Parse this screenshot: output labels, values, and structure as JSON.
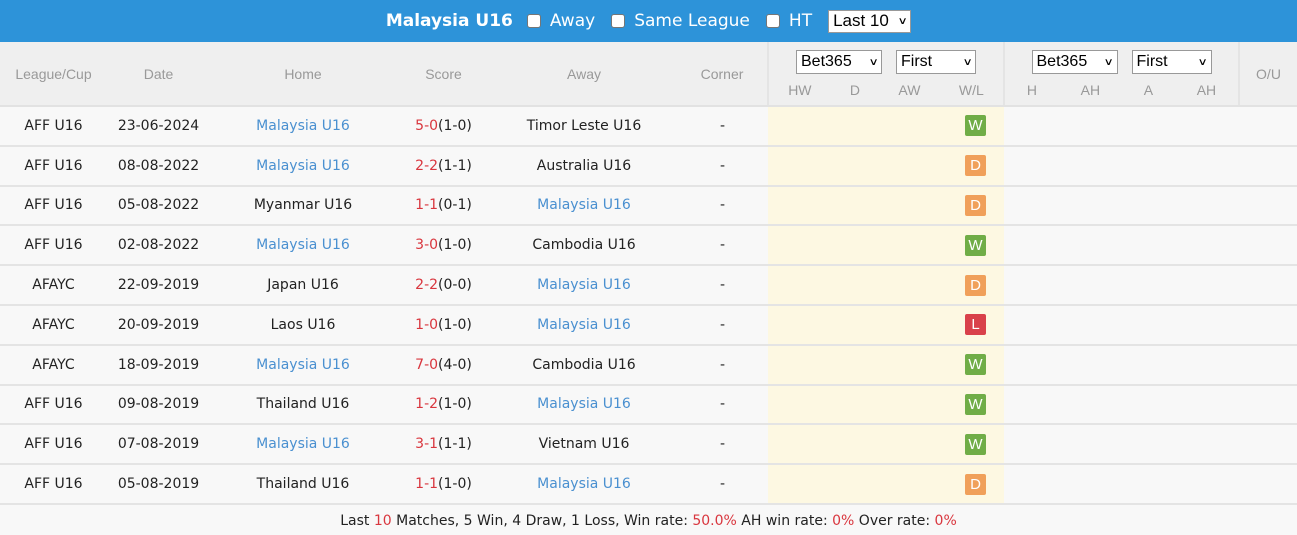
{
  "topbar": {
    "team": "Malaysia U16",
    "options": [
      {
        "label": "Away",
        "checked": false
      },
      {
        "label": "Same League",
        "checked": false
      },
      {
        "label": "HT",
        "checked": false
      }
    ],
    "range_select": "Last 10"
  },
  "colors": {
    "header_blue": "#2d93d9",
    "team_highlight": "#4a90d0",
    "score_red": "#d9363e",
    "win": "#70ad47",
    "draw": "#f0a05a",
    "loss": "#d9414a",
    "odds_bg": "#fdf8e2"
  },
  "columns": {
    "league": "League/Cup",
    "date": "Date",
    "home": "Home",
    "score": "Score",
    "away": "Away",
    "corner": "Corner",
    "odds_group": {
      "company": "Bet365",
      "type": "First",
      "sub": [
        "HW",
        "D",
        "AW",
        "W/L"
      ]
    },
    "ah_group": {
      "company": "Bet365",
      "type": "First",
      "sub": [
        "H",
        "AH",
        "A",
        "AH"
      ]
    },
    "ou": "O/U"
  },
  "matches": [
    {
      "league": "AFF U16",
      "date": "23-06-2024",
      "home": "Malaysia U16",
      "ft": "5-0",
      "ht": "(1-0)",
      "away": "Timor Leste U16",
      "corner": "-",
      "result": "W",
      "team_side": "home"
    },
    {
      "league": "AFF U16",
      "date": "08-08-2022",
      "home": "Malaysia U16",
      "ft": "2-2",
      "ht": "(1-1)",
      "away": "Australia U16",
      "corner": "-",
      "result": "D",
      "team_side": "home"
    },
    {
      "league": "AFF U16",
      "date": "05-08-2022",
      "home": "Myanmar U16",
      "ft": "1-1",
      "ht": "(0-1)",
      "away": "Malaysia U16",
      "corner": "-",
      "result": "D",
      "team_side": "away"
    },
    {
      "league": "AFF U16",
      "date": "02-08-2022",
      "home": "Malaysia U16",
      "ft": "3-0",
      "ht": "(1-0)",
      "away": "Cambodia U16",
      "corner": "-",
      "result": "W",
      "team_side": "home"
    },
    {
      "league": "AFAYC",
      "date": "22-09-2019",
      "home": "Japan U16",
      "ft": "2-2",
      "ht": "(0-0)",
      "away": "Malaysia U16",
      "corner": "-",
      "result": "D",
      "team_side": "away"
    },
    {
      "league": "AFAYC",
      "date": "20-09-2019",
      "home": "Laos U16",
      "ft": "1-0",
      "ht": "(1-0)",
      "away": "Malaysia U16",
      "corner": "-",
      "result": "L",
      "team_side": "away"
    },
    {
      "league": "AFAYC",
      "date": "18-09-2019",
      "home": "Malaysia U16",
      "ft": "7-0",
      "ht": "(4-0)",
      "away": "Cambodia U16",
      "corner": "-",
      "result": "W",
      "team_side": "home"
    },
    {
      "league": "AFF U16",
      "date": "09-08-2019",
      "home": "Thailand U16",
      "ft": "1-2",
      "ht": "(1-0)",
      "away": "Malaysia U16",
      "corner": "-",
      "result": "W",
      "team_side": "away"
    },
    {
      "league": "AFF U16",
      "date": "07-08-2019",
      "home": "Malaysia U16",
      "ft": "3-1",
      "ht": "(1-1)",
      "away": "Vietnam U16",
      "corner": "-",
      "result": "W",
      "team_side": "home"
    },
    {
      "league": "AFF U16",
      "date": "05-08-2019",
      "home": "Thailand U16",
      "ft": "1-1",
      "ht": "(1-0)",
      "away": "Malaysia U16",
      "corner": "-",
      "result": "D",
      "team_side": "away"
    }
  ],
  "summary": {
    "prefix": "Last ",
    "count": "10",
    "matches_text": " Matches, 5 Win, 4 Draw, 1 Loss, Win rate: ",
    "win_rate": "50.0%",
    "ah_label": " AH win rate: ",
    "ah_rate": "0%",
    "over_label": " Over rate: ",
    "over_rate": "0%"
  }
}
